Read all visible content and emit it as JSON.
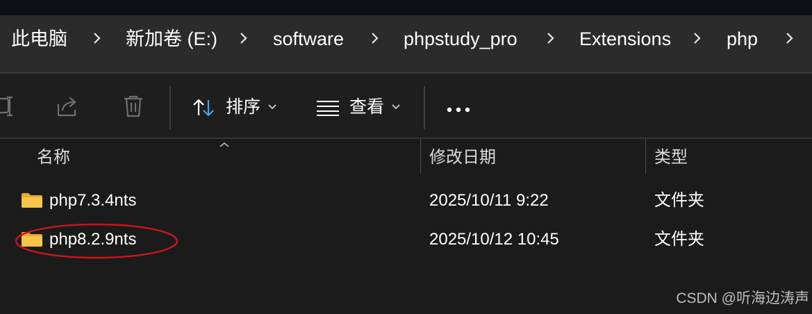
{
  "breadcrumb": {
    "items": [
      "此电脑",
      "新加卷 (E:)",
      "software",
      "phpstudy_pro",
      "Extensions",
      "php"
    ]
  },
  "toolbar": {
    "sort_label": "排序",
    "view_label": "查看",
    "icons": [
      "rename-icon",
      "share-icon",
      "delete-icon",
      "sort-icon",
      "view-icon",
      "more-icon"
    ]
  },
  "columns": {
    "name": "名称",
    "modified": "修改日期",
    "type": "类型"
  },
  "rows": [
    {
      "name": "php7.3.4nts",
      "modified": "2025/10/11 9:22",
      "type": "文件夹"
    },
    {
      "name": "php8.2.9nts",
      "modified": "2025/10/12 10:45",
      "type": "文件夹"
    }
  ],
  "annotation": {
    "color": "#c8161d",
    "target": "php8.2.9nts"
  },
  "watermark": "CSDN @听海边涛声",
  "colors": {
    "background": "#1b1b1b",
    "breadcrumb_bg": "#2b2b2b",
    "folder": "#f6c54a"
  }
}
